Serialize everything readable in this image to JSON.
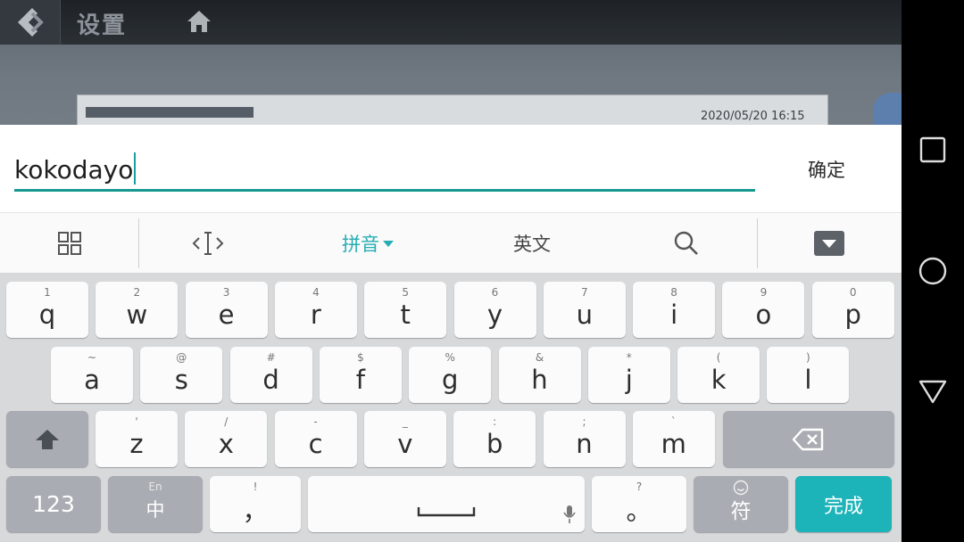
{
  "background_app": {
    "title": "设置",
    "timestamp": "2020/05/20 16:15"
  },
  "input": {
    "value": "kokodayo",
    "confirm_label": "确定"
  },
  "toolbar": {
    "pinyin_label": "拼音",
    "english_label": "英文"
  },
  "keyboard": {
    "row1": [
      {
        "hint": "1",
        "label": "q"
      },
      {
        "hint": "2",
        "label": "w"
      },
      {
        "hint": "3",
        "label": "e"
      },
      {
        "hint": "4",
        "label": "r"
      },
      {
        "hint": "5",
        "label": "t"
      },
      {
        "hint": "6",
        "label": "y"
      },
      {
        "hint": "7",
        "label": "u"
      },
      {
        "hint": "8",
        "label": "i"
      },
      {
        "hint": "9",
        "label": "o"
      },
      {
        "hint": "0",
        "label": "p"
      }
    ],
    "row2": [
      {
        "hint": "~",
        "label": "a"
      },
      {
        "hint": "@",
        "label": "s"
      },
      {
        "hint": "#",
        "label": "d"
      },
      {
        "hint": "$",
        "label": "f"
      },
      {
        "hint": "%",
        "label": "g"
      },
      {
        "hint": "&",
        "label": "h"
      },
      {
        "hint": "*",
        "label": "j"
      },
      {
        "hint": "(",
        "label": "k"
      },
      {
        "hint": ")",
        "label": "l"
      }
    ],
    "row3": [
      {
        "hint": "'",
        "label": "z"
      },
      {
        "hint": "/",
        "label": "x"
      },
      {
        "hint": "-",
        "label": "c"
      },
      {
        "hint": "_",
        "label": "v"
      },
      {
        "hint": ":",
        "label": "b"
      },
      {
        "hint": ";",
        "label": "n"
      },
      {
        "hint": "`",
        "label": "m"
      }
    ],
    "num_key": "123",
    "lang_hint": "En",
    "lang_key": "中",
    "comma_hint": "!",
    "comma_key": "，",
    "period_hint": "?",
    "period_key": "。",
    "symbol_key": "符",
    "done_key": "完成"
  },
  "colors": {
    "accent": "#1cb3b9",
    "underline": "#17988f",
    "keyboard_bg": "#d8d9db"
  },
  "icons": [
    "back-icon",
    "home-icon",
    "grid-icon",
    "cursor-move-icon",
    "dropdown-arrow-icon",
    "search-icon",
    "hide-keyboard-icon",
    "shift-icon",
    "backspace-icon",
    "mic-icon",
    "smiley-icon",
    "recents-icon",
    "home-circle-icon",
    "back-triangle-icon"
  ]
}
